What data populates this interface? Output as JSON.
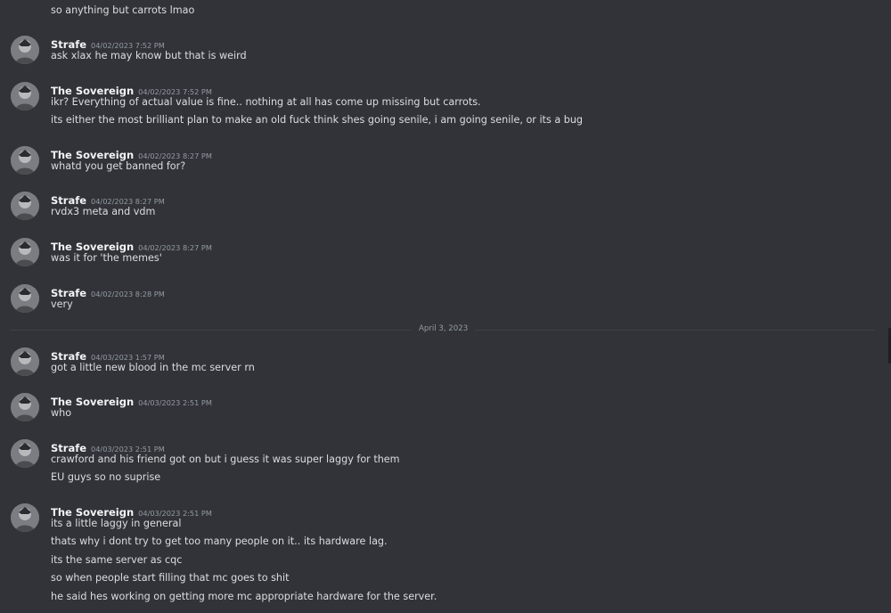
{
  "chat": {
    "top_line": "so anything but carrots lmao",
    "date_divider": "April 3, 2023",
    "messages": [
      {
        "author": "Strafe",
        "time": "04/02/2023 7:52 PM",
        "lines": [
          "ask xlax he may know but that is weird"
        ]
      },
      {
        "author": "The Sovereign",
        "time": "04/02/2023 7:52 PM",
        "lines": [
          "ikr?  Everything of actual value is fine.. nothing at all has come up missing but carrots.",
          "its either the most brilliant plan to make an old fuck think shes going senile, i am going senile, or its a bug"
        ]
      },
      {
        "author": "The Sovereign",
        "time": "04/02/2023 8:27 PM",
        "lines": [
          "whatd you get banned for?"
        ]
      },
      {
        "author": "Strafe",
        "time": "04/02/2023 8:27 PM",
        "lines": [
          "rvdx3 meta and vdm"
        ]
      },
      {
        "author": "The Sovereign",
        "time": "04/02/2023 8:27 PM",
        "lines": [
          "was it for 'the memes'"
        ]
      },
      {
        "author": "Strafe",
        "time": "04/02/2023 8:28 PM",
        "lines": [
          "very"
        ]
      },
      {
        "author": "Strafe",
        "time": "04/03/2023 1:57 PM",
        "lines": [
          "got a little new blood in the mc server rn"
        ]
      },
      {
        "author": "The Sovereign",
        "time": "04/03/2023 2:51 PM",
        "lines": [
          "who"
        ]
      },
      {
        "author": "Strafe",
        "time": "04/03/2023 2:51 PM",
        "lines": [
          "crawford and his friend got on but i guess it was super laggy for them",
          "EU guys so no suprise"
        ]
      },
      {
        "author": "The Sovereign",
        "time": "04/03/2023 2:51 PM",
        "lines": [
          "its a little laggy in general",
          "thats why i dont try to get too many people on it.. its hardware lag.",
          "its the same server as cqc",
          "so when people start filling that mc goes to shit",
          "he said hes working on getting more mc appropriate hardware for the server."
        ]
      }
    ]
  },
  "colors": {
    "background": "#313338",
    "username": "#f2f3f5",
    "text": "#dbdee1",
    "timestamp": "#949ba4"
  },
  "icons": {
    "avatar": "user-avatar-icon"
  }
}
